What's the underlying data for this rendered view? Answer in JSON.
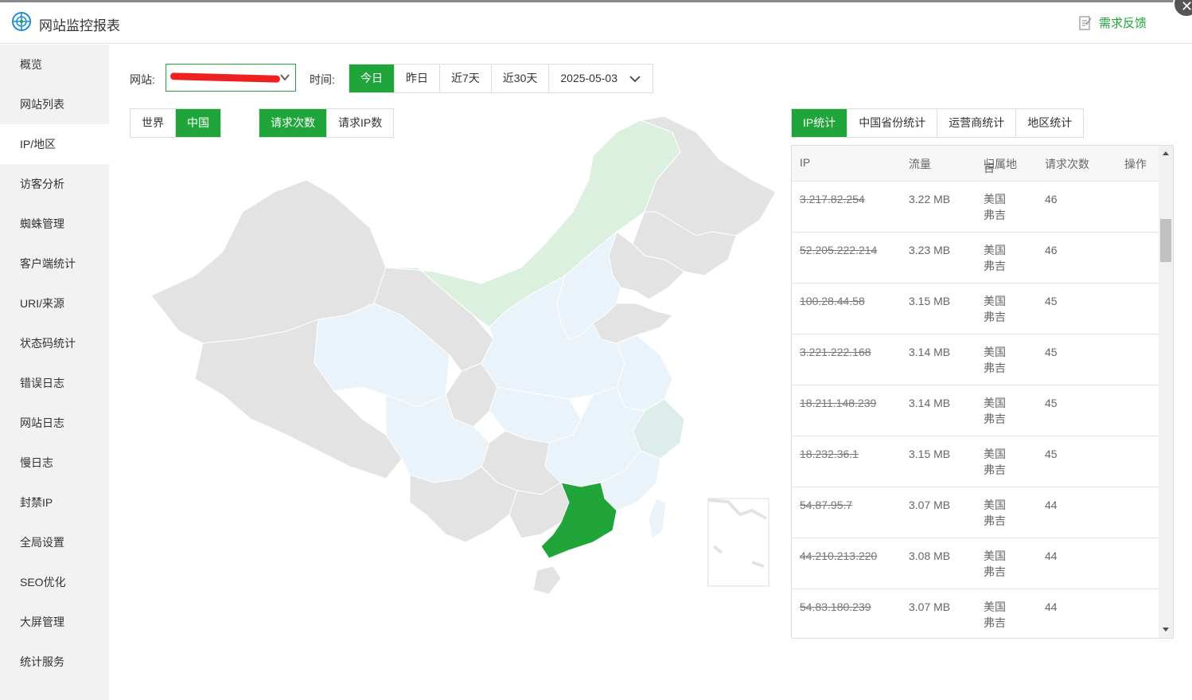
{
  "window": {
    "title": "网站监控报表",
    "close_label": "✕",
    "feedback_label": "需求反馈"
  },
  "sidebar": {
    "items": [
      {
        "label": "概览"
      },
      {
        "label": "网站列表"
      },
      {
        "label": "IP/地区",
        "active": true
      },
      {
        "label": "访客分析"
      },
      {
        "label": "蜘蛛管理"
      },
      {
        "label": "客户端统计"
      },
      {
        "label": "URI/来源"
      },
      {
        "label": "状态码统计"
      },
      {
        "label": "错误日志"
      },
      {
        "label": "网站日志"
      },
      {
        "label": "慢日志"
      },
      {
        "label": "封禁IP"
      },
      {
        "label": "全局设置"
      },
      {
        "label": "SEO优化"
      },
      {
        "label": "大屏管理"
      },
      {
        "label": "统计服务"
      }
    ]
  },
  "filters": {
    "site_label": "网站:",
    "time_label": "时间:",
    "time_options": [
      "今日",
      "昨日",
      "近7天",
      "近30天"
    ],
    "time_selected": "今日",
    "date_value": "2025-05-03"
  },
  "map_controls": {
    "region_tabs": [
      "世界",
      "中国"
    ],
    "region_selected": "中国",
    "metric_tabs": [
      "请求次数",
      "请求IP数"
    ],
    "metric_selected": "请求次数"
  },
  "stats_tabs": {
    "items": [
      "IP统计",
      "中国省份统计",
      "运营商统计",
      "地区统计"
    ],
    "selected": "IP统计"
  },
  "ip_table": {
    "columns": [
      "IP",
      "流量",
      "归属地",
      "请求次数",
      "操作"
    ],
    "partial_top_loc": "吉",
    "rows": [
      {
        "ip": "3.217.82.254",
        "traffic": "3.22 MB",
        "location": "美国 弗吉",
        "requests": "46"
      },
      {
        "ip": "52.205.222.214",
        "traffic": "3.23 MB",
        "location": "美国 弗吉",
        "requests": "46"
      },
      {
        "ip": "100.28.44.58",
        "traffic": "3.15 MB",
        "location": "美国 弗吉",
        "requests": "45"
      },
      {
        "ip": "3.221.222.168",
        "traffic": "3.14 MB",
        "location": "美国 弗吉",
        "requests": "45"
      },
      {
        "ip": "18.211.148.239",
        "traffic": "3.14 MB",
        "location": "美国 弗吉",
        "requests": "45"
      },
      {
        "ip": "18.232.36.1",
        "traffic": "3.15 MB",
        "location": "美国 弗吉",
        "requests": "45"
      },
      {
        "ip": "54.87.95.7",
        "traffic": "3.07 MB",
        "location": "美国 弗吉",
        "requests": "44"
      },
      {
        "ip": "44.210.213.220",
        "traffic": "3.08 MB",
        "location": "美国 弗吉",
        "requests": "44"
      },
      {
        "ip": "54.83.180.239",
        "traffic": "3.07 MB",
        "location": "美国 弗吉",
        "requests": "44"
      }
    ]
  },
  "colors": {
    "accent": "#20a53a",
    "map_gray": "#e3e3e3",
    "map_light_blue": "#eaf2fa",
    "map_light_green": "#dcf0df",
    "map_teal": "#ddeeea",
    "map_highlight": "#21a53a"
  }
}
